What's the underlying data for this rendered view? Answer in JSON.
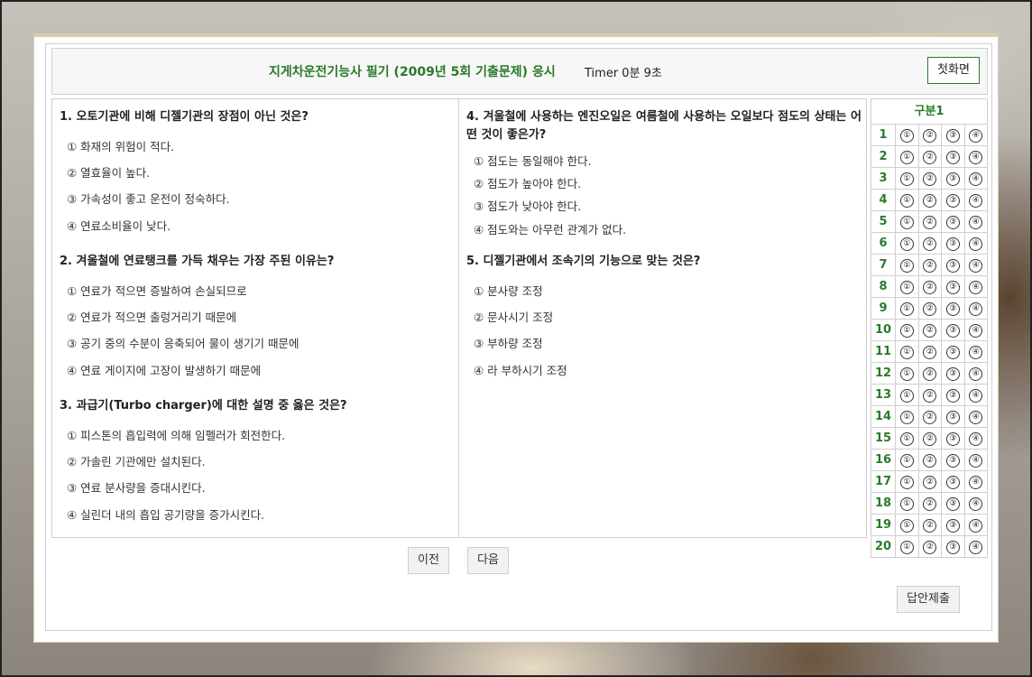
{
  "header": {
    "title": "지게차운전기능사 필기 (2009년 5회 기출문제) 응시",
    "timer": "Timer 0분 9초",
    "home_button": "첫화면"
  },
  "questions_left": [
    {
      "text": "1.  오토기관에 비해 디젤기관의 장점이 아닌 것은?",
      "options": [
        "① 화재의 위험이 적다.",
        "② 열효율이 높다.",
        "③ 가속성이 좋고 운전이 정숙하다.",
        "④ 연료소비율이 낮다."
      ]
    },
    {
      "text": "2.  겨울철에 연료탱크를 가득 채우는 가장 주된 이유는?",
      "options": [
        "① 연료가 적으면 증발하여 손실되므로",
        "② 연료가 적으면 출렁거리기 때문에",
        "③ 공기 중의 수분이 응축되어 물이 생기기 때문에",
        "④ 연료 게이지에 고장이 발생하기 때문에"
      ]
    },
    {
      "text": "3.  과급기(Turbo charger)에 대한 설명 중 옳은 것은?",
      "options": [
        "① 피스톤의 흡입력에 의해 임펠러가 회전한다.",
        "② 가솔린 기관에만 설치된다.",
        "③ 연료 분사량을 증대시킨다.",
        "④ 실린더 내의 흡입 공기량을 증가시킨다."
      ]
    }
  ],
  "questions_right": [
    {
      "text": "4.  겨울철에 사용하는 엔진오일은 여름철에 사용하는 오일보다 점도의 상태는 어떤 것이 좋은가?",
      "options": [
        "① 점도는 동일해야 한다.",
        "② 점도가 높아야 한다.",
        "③ 점도가 낮아야 한다.",
        "④ 점도와는 아무런 관계가 없다."
      ]
    },
    {
      "text": "5.  디젤기관에서 조속기의 기능으로 맞는 것은?",
      "options": [
        "① 분사량 조정",
        "② 문사시기 조정",
        "③ 부하량 조정",
        "④ 라 부하시기 조정"
      ]
    }
  ],
  "nav": {
    "prev": "이전",
    "next": "다음"
  },
  "answer_sheet": {
    "title": "구분1",
    "numbers": [
      "1",
      "2",
      "3",
      "4",
      "5",
      "6",
      "7",
      "8",
      "9",
      "10",
      "11",
      "12",
      "13",
      "14",
      "15",
      "16",
      "17",
      "18",
      "19",
      "20"
    ],
    "choices": [
      "①",
      "②",
      "③",
      "④"
    ]
  },
  "submit": "답안제출"
}
